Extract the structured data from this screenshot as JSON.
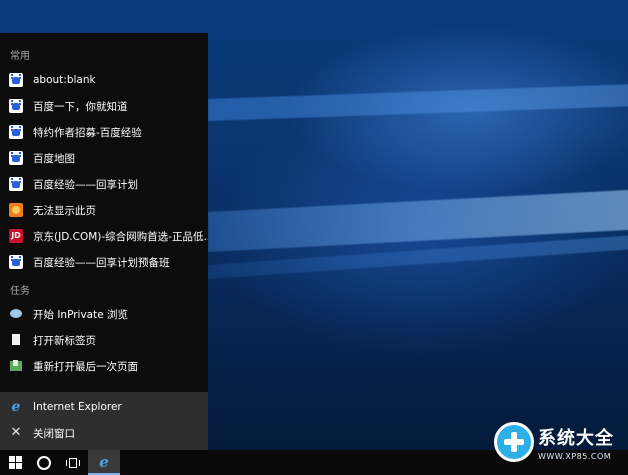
{
  "jumplist": {
    "frequent_label": "常用",
    "frequent_items": [
      {
        "label": "about:blank",
        "icon": "baidu-paw-icon"
      },
      {
        "label": "百度一下，你就知道",
        "icon": "baidu-paw-icon"
      },
      {
        "label": "特约作者招募-百度经验",
        "icon": "baidu-paw-icon"
      },
      {
        "label": "百度地图",
        "icon": "baidu-paw-icon"
      },
      {
        "label": "百度经验——回享计划",
        "icon": "baidu-paw-icon"
      },
      {
        "label": "无法显示此页",
        "icon": "error-page-icon"
      },
      {
        "label": "京东(JD.COM)-综合网购首选-正品低...",
        "icon": "jd-icon"
      },
      {
        "label": "百度经验——回享计划预备班",
        "icon": "baidu-paw-icon"
      }
    ],
    "tasks_label": "任务",
    "task_items": [
      {
        "label": "开始 InPrivate 浏览",
        "icon": "inprivate-icon"
      },
      {
        "label": "打开新标签页",
        "icon": "new-tab-icon"
      },
      {
        "label": "重新打开最后一次页面",
        "icon": "reopen-session-icon"
      }
    ],
    "app_item": {
      "label": "Internet Explorer",
      "icon_glyph": "e"
    },
    "close_item": {
      "label": "关闭窗口",
      "icon_glyph": "✕"
    }
  },
  "taskbar": {
    "ie_glyph": "e"
  },
  "watermark": {
    "title": "系统大全",
    "url": "WWW.XP85.COM"
  },
  "colors": {
    "jumplist_bg": "#0c0c0c",
    "jumplist_bottom_bg": "#2e2e2e",
    "taskbar_bg": "#0a0a0a",
    "ie_blue": "#48a5e8",
    "jd_red": "#c8102e"
  }
}
